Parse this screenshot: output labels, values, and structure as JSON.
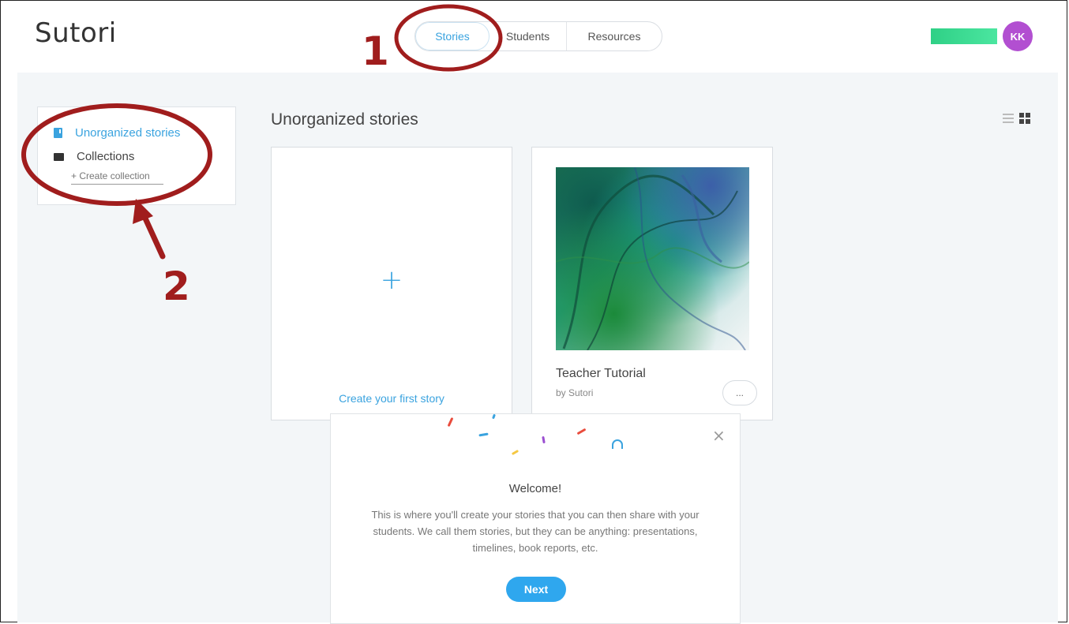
{
  "header": {
    "logo": "Sutori",
    "nav": {
      "stories": "Stories",
      "students": "Students",
      "resources": "Resources"
    },
    "avatar_initials": "KK"
  },
  "sidebar": {
    "items": [
      {
        "label": "Unorganized stories",
        "active": true,
        "icon": "book-icon"
      },
      {
        "label": "Collections",
        "active": false,
        "icon": "folder-icon"
      }
    ],
    "create_collection": "+ Create collection"
  },
  "main": {
    "title": "Unorganized stories",
    "create_card": {
      "plus": "+",
      "label": "Create your first story"
    },
    "story_card": {
      "title": "Teacher Tutorial",
      "byline": "by Sutori",
      "more": "..."
    }
  },
  "modal": {
    "close": "×",
    "title": "Welcome!",
    "body": "This is where you'll create your stories that you can then share with your students. We call them stories, but they can be anything: presentations, timelines, book reports, etc.",
    "next": "Next"
  },
  "annotations": {
    "one": "1",
    "two": "2"
  },
  "colors": {
    "accent": "#3aa3df",
    "annotation": "#a01d1d",
    "avatar": "#b24fd1",
    "next_button": "#2fa7ee"
  }
}
